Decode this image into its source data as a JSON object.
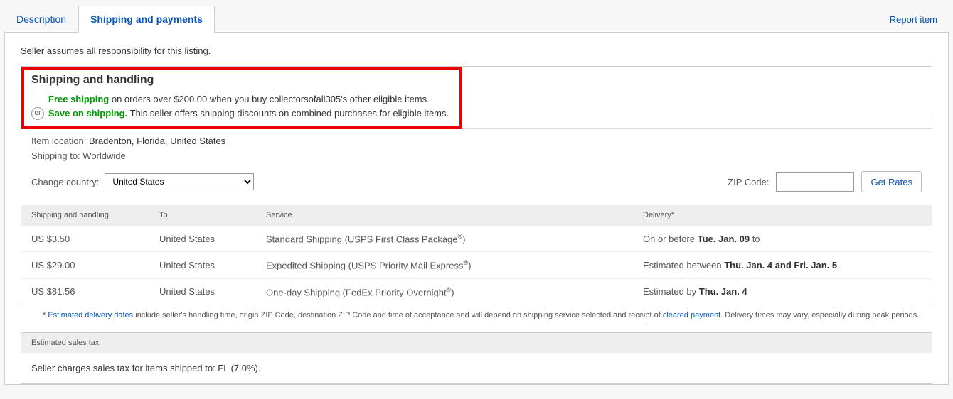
{
  "tabs": {
    "description": "Description",
    "shipping": "Shipping and payments"
  },
  "report_link": "Report item",
  "responsibility": "Seller assumes all responsibility for this listing.",
  "shipping_section": {
    "title": "Shipping and handling",
    "or_badge": "or",
    "promo1": {
      "strong": "Free shipping",
      "rest": " on orders over $200.00 when you buy collectorsofall305's other eligible items."
    },
    "promo2": {
      "strong": "Save on shipping.",
      "rest": " This seller offers shipping discounts on combined purchases for eligible items."
    },
    "item_location_label": "Item location: ",
    "item_location_value": "Bradenton, Florida, United States",
    "shipping_to_label": "Shipping to: ",
    "shipping_to_value": "Worldwide",
    "change_country_label": "Change country:",
    "country_selected": "United States",
    "zip_label": "ZIP Code:",
    "zip_value": "",
    "get_rates": "Get Rates"
  },
  "rates_table": {
    "headers": {
      "sh": "Shipping and handling",
      "to": "To",
      "service": "Service",
      "delivery": "Delivery*"
    },
    "rows": [
      {
        "price": "US $3.50",
        "to": "United States",
        "service_pre": "Standard Shipping (USPS First Class Package",
        "delivery_pre": "On or before ",
        "delivery_bold": "Tue. Jan. 09",
        "delivery_post": " to"
      },
      {
        "price": "US $29.00",
        "to": "United States",
        "service_pre": "Expedited Shipping (USPS Priority Mail Express",
        "delivery_pre": "Estimated between ",
        "delivery_bold": "Thu. Jan. 4 and Fri. Jan. 5",
        "delivery_post": ""
      },
      {
        "price": "US $81.56",
        "to": "United States",
        "service_pre": "One-day Shipping (FedEx Priority Overnight",
        "delivery_pre": "Estimated by ",
        "delivery_bold": "Thu. Jan. 4",
        "delivery_post": ""
      }
    ]
  },
  "footnote": {
    "star": "* ",
    "link1": "Estimated delivery dates",
    "mid": " include seller's handling time, origin ZIP Code, destination ZIP Code and time of acceptance and will depend on shipping service selected and receipt of ",
    "link2": "cleared payment",
    "end": ". Delivery times may vary, especially during peak periods."
  },
  "tax": {
    "header": "Estimated sales tax",
    "body": "Seller charges sales tax for items shipped to: FL (7.0%)."
  }
}
